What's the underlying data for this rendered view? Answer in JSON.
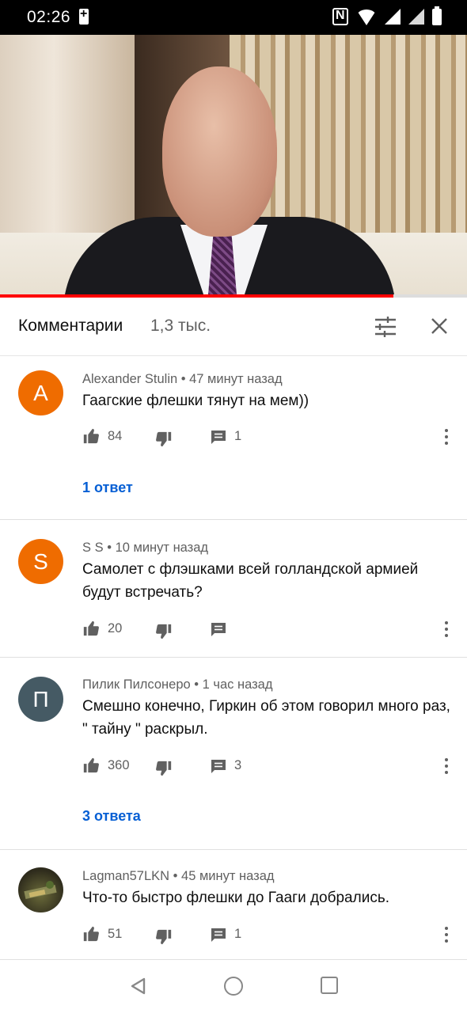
{
  "status_bar": {
    "time": "02:26"
  },
  "comments_panel": {
    "title": "Комментарии",
    "count": "1,3 тыс.",
    "icons": {
      "filter": "sort-filter-icon",
      "close": "close-icon"
    }
  },
  "colors": {
    "progress": "#ff0000",
    "link": "#065fd4",
    "avatar_orange": "#ef6c00",
    "avatar_slate": "#455a64"
  },
  "comments": [
    {
      "avatar_letter": "A",
      "author": "Alexander Stulin",
      "time": "47 минут назад",
      "text": "Гаагские флешки тянут на мем))",
      "likes": "84",
      "replies": "1",
      "replies_link": "1 ответ"
    },
    {
      "avatar_letter": "S",
      "author": "S S",
      "time": "10 минут назад",
      "text": "Самолет с флэшками всей голландской армией будут встречать?",
      "likes": "20",
      "replies": "",
      "replies_link": ""
    },
    {
      "avatar_letter": "П",
      "author": "Пилик Пилсонеро",
      "time": "1 час назад",
      "text": "Смешно конечно, Гиркин об этом говорил много раз,  \" тайну \" раскрыл.",
      "likes": "360",
      "replies": "3",
      "replies_link": "3 ответа"
    },
    {
      "avatar_letter": "",
      "author": "Lagman57LKN",
      "time": "45 минут назад",
      "text": "Что-то быстро флешки до Гааги добрались.",
      "likes": "51",
      "replies": "1",
      "replies_link": ""
    }
  ]
}
